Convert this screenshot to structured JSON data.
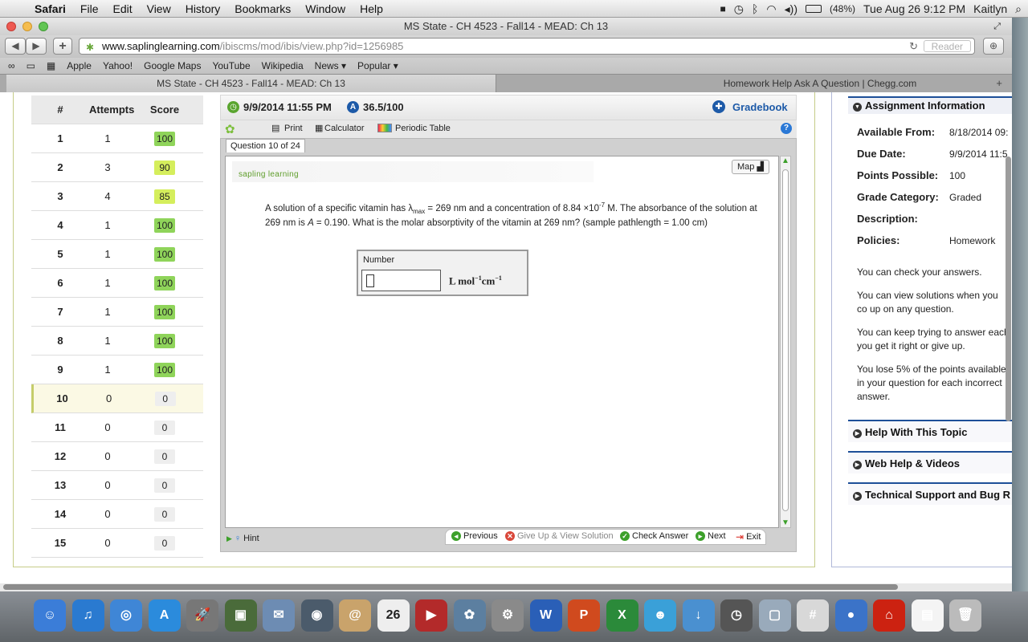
{
  "menubar": {
    "app": "Safari",
    "items": [
      "File",
      "Edit",
      "View",
      "History",
      "Bookmarks",
      "Window",
      "Help"
    ],
    "battery": "(48%)",
    "datetime": "Tue Aug 26  9:12 PM",
    "user": "Kaitlyn"
  },
  "window": {
    "title": "MS State - CH 4523 - Fall14 - MEAD: Ch 13"
  },
  "toolbar": {
    "url_host": "www.saplinglearning.com",
    "url_path": "/ibiscms/mod/ibis/view.php?id=1256985",
    "reader_label": "Reader",
    "plus_label": "+"
  },
  "bookmarks": [
    "Apple",
    "Yahoo!",
    "Google Maps",
    "YouTube",
    "Wikipedia",
    "News ▾",
    "Popular ▾"
  ],
  "tabs": [
    {
      "label": "MS State - CH 4523 - Fall14 - MEAD: Ch 13"
    },
    {
      "label": "Homework Help Ask A Question | Chegg.com"
    }
  ],
  "question_list": {
    "headers": {
      "num": "#",
      "attempts": "Attempts",
      "score": "Score"
    },
    "rows": [
      {
        "num": "1",
        "attempts": "1",
        "score": "100"
      },
      {
        "num": "2",
        "attempts": "3",
        "score": "90"
      },
      {
        "num": "3",
        "attempts": "4",
        "score": "85"
      },
      {
        "num": "4",
        "attempts": "1",
        "score": "100"
      },
      {
        "num": "5",
        "attempts": "1",
        "score": "100"
      },
      {
        "num": "6",
        "attempts": "1",
        "score": "100"
      },
      {
        "num": "7",
        "attempts": "1",
        "score": "100"
      },
      {
        "num": "8",
        "attempts": "1",
        "score": "100"
      },
      {
        "num": "9",
        "attempts": "1",
        "score": "100"
      },
      {
        "num": "10",
        "attempts": "0",
        "score": "0"
      },
      {
        "num": "11",
        "attempts": "0",
        "score": "0"
      },
      {
        "num": "12",
        "attempts": "0",
        "score": "0"
      },
      {
        "num": "13",
        "attempts": "0",
        "score": "0"
      },
      {
        "num": "14",
        "attempts": "0",
        "score": "0"
      },
      {
        "num": "15",
        "attempts": "0",
        "score": "0"
      }
    ]
  },
  "question": {
    "due": "9/9/2014 11:55 PM",
    "points": "36.5/100",
    "gradebook": "Gradebook",
    "print": "Print",
    "calculator": "Calculator",
    "periodic_table": "Periodic Table",
    "tab_label": "Question 10 of 24",
    "map_label": "Map",
    "logo": "sapling learning",
    "text_a": "A solution of a specific vitamin has λ",
    "text_sub": "max",
    "text_b": " = 269 nm and a concentration of 8.84 ×10",
    "text_exp": "-7",
    "text_c": " M. The absorbance of the solution at 269 nm is ",
    "text_A": "A",
    "text_d": " = 0.190. What is the molar absorptivity of the vitamin at 269 nm? (sample pathlength = 1.00 cm)",
    "number_label": "Number",
    "unit_a": "L  mol",
    "unit_exp1": "−1",
    "unit_b": "cm",
    "unit_exp2": "−1",
    "answer_value": "",
    "footer": {
      "hint": "Hint",
      "previous": "Previous",
      "give_up": "Give Up & View Solution",
      "check": "Check Answer",
      "next": "Next",
      "exit": "Exit"
    }
  },
  "assignment": {
    "header": "Assignment Information",
    "labels": {
      "available": "Available From:",
      "due": "Due Date:",
      "points": "Points Possible:",
      "category": "Grade Category:",
      "description": "Description:",
      "policies": "Policies:"
    },
    "values": {
      "available": "8/18/2014 09:",
      "due": "9/9/2014 11:5",
      "points": "100",
      "category": "Graded",
      "policies": "Homework"
    },
    "policy_lines": [
      "You can check your answers.",
      "You can view solutions when you co up on any question.",
      "You can keep trying to answer each you get it right or give up.",
      "You lose 5% of the points available in your question for each incorrect answer."
    ],
    "sections": [
      "Help With This Topic",
      "Web Help & Videos",
      "Technical Support and Bug R"
    ]
  },
  "dock_icons": [
    "finder",
    "itunes",
    "safari",
    "app-store",
    "launchpad",
    "photo-booth",
    "mail",
    "facetime",
    "contacts",
    "calendar",
    "dvd",
    "iphoto",
    "system-prefs",
    "word",
    "powerpoint",
    "excel",
    "messenger",
    "downloads",
    "time-machine",
    "preview",
    "calculator",
    "chrome",
    "acrobat",
    "html-doc",
    "trash"
  ],
  "calendar_day": "26"
}
